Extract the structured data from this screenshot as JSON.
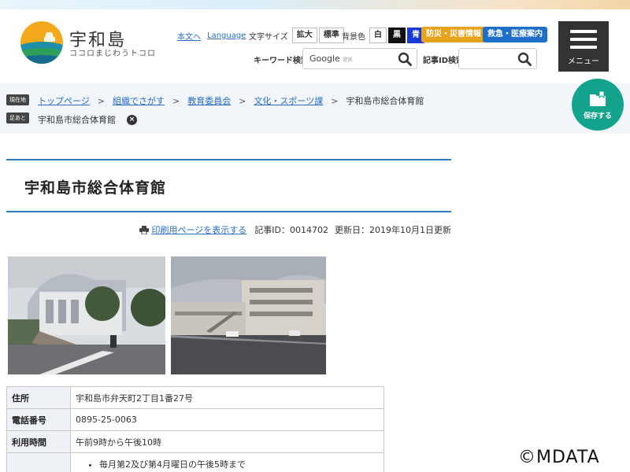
{
  "header": {
    "logo_title": "宇和島",
    "logo_tagline": "ココロまじわうトコロ"
  },
  "utility": {
    "skip_link": "本文へ",
    "language_link": "Language",
    "font_size_label": "文字サイズ",
    "font_enlarge": "拡大",
    "font_standard": "標準",
    "bg_color_label": "背景色",
    "bg_white": "白",
    "bg_black": "黒",
    "bg_blue": "青",
    "disaster_info": "防災・災害情報",
    "emergency_info": "救急・医療案内"
  },
  "search": {
    "keyword_label": "キーワード検索",
    "google_label": "Google",
    "google_provided": "提供",
    "article_id_label": "記事ID検索"
  },
  "menu": {
    "label": "メニュー"
  },
  "breadcrumb": {
    "current_badge": "現在地",
    "trail_badge": "足あと",
    "items": [
      "トップページ",
      "組織でさがす",
      "教育委員会",
      "文化・スポーツ課",
      "宇和島市総合体育館"
    ],
    "separator": ">",
    "trail_item": "宇和島市総合体育館"
  },
  "save": {
    "label": "保存する"
  },
  "page": {
    "title": "宇和島市総合体育館",
    "print_link": "印刷用ページを表示する",
    "article_id": "記事ID：0014702",
    "updated": "更新日：2019年10月1日更新"
  },
  "info_table": {
    "rows": [
      {
        "key": "住所",
        "value": "宇和島市弁天町2丁目1番27号"
      },
      {
        "key": "電話番号",
        "value": "0895-25-0063"
      },
      {
        "key": "利用時間",
        "value": "午前9時から午後10時"
      },
      {
        "key": "",
        "value": "毎月第2及び第4月曜日の午後5時まで"
      }
    ]
  },
  "watermark": "©MDATA",
  "colors": {
    "accent_blue": "#2f7bbf",
    "link": "#2a6fbf",
    "disaster_orange": "#e8a21c",
    "emergency_blue": "#1e6fc9",
    "save_green": "#14a38c",
    "menu_dark": "#333333"
  }
}
